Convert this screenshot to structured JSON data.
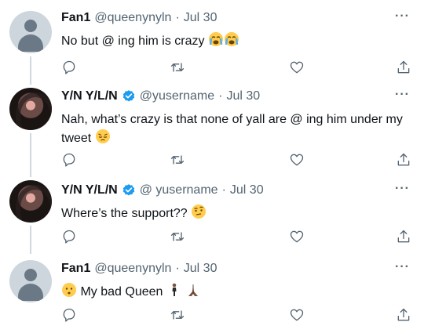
{
  "tweets": [
    {
      "name": "Fan1",
      "handle": "@queenynyln",
      "sep": "·",
      "date": "Jul 30",
      "text": "No but @ ing him is crazy",
      "emojis": [
        "loudly-crying-face",
        "loudly-crying-face"
      ],
      "avatar": "default-avatar",
      "verified": false
    },
    {
      "name": "Y/N Y/L/N",
      "handle": "@yusername",
      "sep": "·",
      "date": "Jul 30",
      "text": "Nah, what’s crazy is that none of yall are @ ing him under my tweet",
      "emojis": [
        "pensive-face"
      ],
      "avatar": "photo-avatar",
      "verified": true
    },
    {
      "name": "Y/N Y/L/N",
      "handle": "@ yusername",
      "sep": "·",
      "date": "Jul 30",
      "text": "Where’s the support??",
      "emojis": [
        "face-with-raised-eyebrow"
      ],
      "avatar": "photo-avatar",
      "verified": true
    },
    {
      "name": "Fan1",
      "handle": "@queenynyln",
      "sep": "·",
      "date": "Jul 30",
      "text": "My bad Queen",
      "emojis_before": [
        "hushed-face"
      ],
      "emojis": [
        "person-standing",
        "folded-hands"
      ],
      "avatar": "default-avatar",
      "verified": false
    }
  ],
  "more_label": "···",
  "icons": [
    "reply-icon",
    "retweet-icon",
    "like-icon",
    "share-icon",
    "verified-badge-icon"
  ],
  "colors": {
    "verified": "#1d9bf0",
    "meta": "#536471",
    "emoji_yellow": "#ffcc4d",
    "thread_line": "#cfd9de"
  }
}
